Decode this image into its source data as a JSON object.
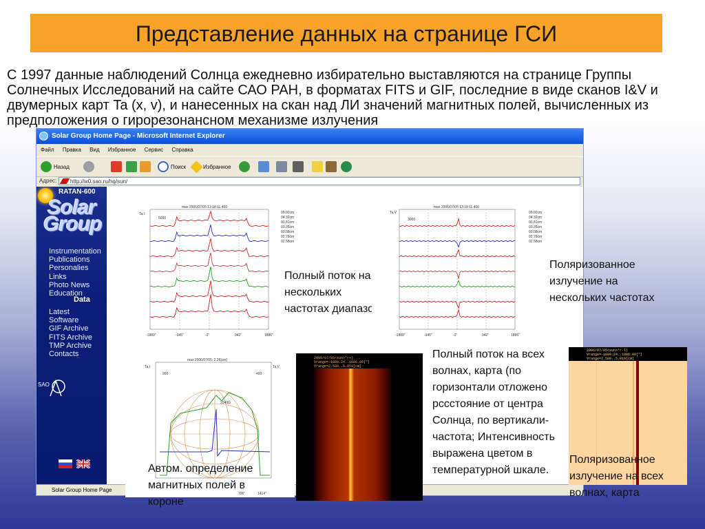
{
  "slide": {
    "title": "Представление данных на странице ГСИ",
    "intro": "С 1997 данные наблюдений Солнца ежедневно избирательно выставляются на странице Группы Солнечных Исследований на сайте САО РАН, в форматах FITS и GIF, последние в виде сканов I&V и двумерных карт Ta (x, v),  и нанесенных на скан над ЛИ значений магнитных полей, вычисленных из предположения о гирорезонансном механизме излучения"
  },
  "browser": {
    "window_title": "Solar Group Home Page - Microsoft Internet Explorer",
    "menu": [
      "Файл",
      "Правка",
      "Вид",
      "Избранное",
      "Сервис",
      "Справка"
    ],
    "toolbar": {
      "back": "Назад",
      "search": "Поиск",
      "favorites": "Избранное"
    },
    "address_label": "Адрес:",
    "address_url": "http://w0.sao.ru/hq/sun/",
    "status_text": "Solar Group Home Page"
  },
  "sidebar": {
    "station": "RATAN-600",
    "logo_line1": "Solar",
    "logo_line2": "Group",
    "links": [
      "Instrumentation",
      "Publications",
      "Personalies",
      "Links",
      "Photo  News",
      "Education"
    ],
    "data_heading": "Data",
    "data_links": [
      "Latest",
      "Software",
      "GIF Archive",
      "FITS Archive",
      "TMP Archive",
      "Contacts"
    ],
    "org_logo": "SAO"
  },
  "panels": {
    "intensity_scan": {
      "title": "max 2006/07/05 13:18:11.400",
      "yaxis": "Ta,I",
      "scale": "5000",
      "x_ticks": [
        "-1889\"",
        "-945\"",
        "-2\"",
        "942\"",
        "1886\""
      ],
      "legend": [
        "05.02cm",
        "04.32cm",
        "03.81cm",
        "03.35cm",
        "03.08cm",
        "02.76cm",
        "02.58cm"
      ],
      "caption": "Полный поток на нескольких частотах диапазона"
    },
    "polarization_scan": {
      "title": "max 2006/07/05 13:18:11.400",
      "yaxis": "Ta,V",
      "scale": "3000",
      "x_ticks": [
        "-1889\"",
        "-945\"",
        "-2\"",
        "942\"",
        "1886\""
      ],
      "legend": [
        "05.02cm",
        "04.32cm",
        "03.81cm",
        "03.35cm",
        "03.08cm",
        "02.76cm",
        "02.58cm"
      ],
      "caption": "Поляризованное излучение на нескольких частотах"
    },
    "magnetic_field": {
      "title": "max 2006/07/05: 2.26[cm]",
      "yaxis_left": "Ta,I",
      "yaxis_right": "Ta,V",
      "scale_left": "900",
      "scale_right": "400",
      "peak_label": "2040G",
      "x_ticks": [
        "706\"",
        "1414\""
      ],
      "caption": "Автом. определение магнитных полей в короне"
    },
    "intensity_map": {
      "header_lines": [
        "2006/07/05<sun>*r+)",
        "Vrange=-1889.24..1886.09[\"]",
        "Vrange=2.580..5.019[cm]"
      ],
      "caption": "Полный поток на всех волнах, карта (по горизонтали отложено рсcстояние от центра Солнца, по вертикали- частота; Интенсивность выражена цветом в температурной шкале."
    },
    "polarization_map": {
      "header_lines": [
        "2006/07/05<sun>*r-l)",
        "Vrange=-1889.24..1886.09[\"]",
        "Vrange=2.580..5.019[cm]"
      ],
      "caption": "Поляризованное излучение на всех волнах, карта"
    }
  },
  "colors": {
    "title_bg": "#f7a32a",
    "sidebar_bg": "#0b1d78",
    "series": [
      "#d42020",
      "#2030c0",
      "#d42020",
      "#c04040",
      "#20a020",
      "#d42020",
      "#d42020"
    ]
  }
}
